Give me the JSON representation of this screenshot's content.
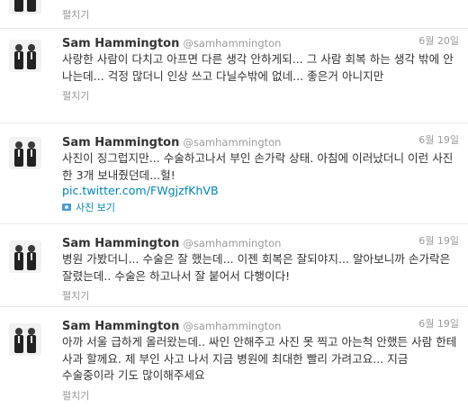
{
  "top_partial": {
    "expand_label": "펼치기"
  },
  "tweets": [
    {
      "name": "Sam Hammington",
      "handle": "@samhammington",
      "date": "6월 20일",
      "text": "사랑한 사람이 다치고 아프면 다른 생각 안하게되... 그 사람 회복 하는 생각 밖에 안 나는데... 걱정 많더니 인상 쓰고 다닐수밖에 없네... 좋은거 아니지만",
      "expand_label": "펼치기"
    },
    {
      "name": "Sam Hammington",
      "handle": "@samhammington",
      "date": "6월 19일",
      "text": "사진이 징그럽지만... 수술하고나서 부인 손가락 상태. 아침에 이러났더니 이런 사진 한 3개 보내줬던데...헐!",
      "link": "pic.twitter.com/FWgjzfKhVB",
      "photo_label": "사진 보기"
    },
    {
      "name": "Sam Hammington",
      "handle": "@samhammington",
      "date": "6월 19일",
      "text": "병원 가봤더니... 수술은 잘 했는데... 이젠 회복은 잘되야지... 알아보니까 손가락은 잘렸는데.. 수술은 하고나서 잘 붙어서 다행이다!",
      "expand_label": "펼치기"
    },
    {
      "name": "Sam Hammington",
      "handle": "@samhammington",
      "date": "6월 19일",
      "text": "아까 서울 급하게 올러왔는데.. 싸인 안해주고 사진 못 찍고 아는척 안했든 사람 한테 사과 할께요. 제 부인 사고 나서 지금 병원에 최대한 빨리 가려고요... 지금 수술중이라 기도 많이해주세요",
      "expand_label": "펼치기"
    }
  ]
}
